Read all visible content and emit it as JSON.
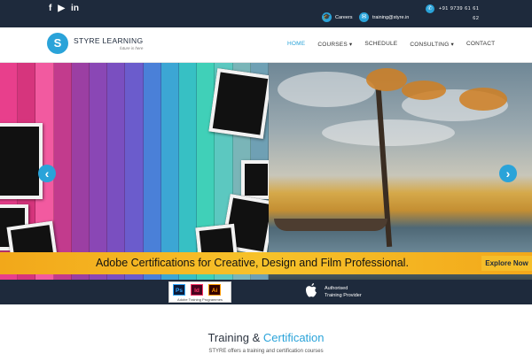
{
  "topbar": {
    "social": [
      {
        "icon": "facebook-icon",
        "glyph": "f"
      },
      {
        "icon": "youtube-icon",
        "glyph": "▶"
      },
      {
        "icon": "linkedin-icon",
        "glyph": "in"
      }
    ],
    "careers_label": "Careers",
    "email": "training@styre.in",
    "phone_line1": "+91 9739 61 61",
    "phone_line2": "62"
  },
  "logo": {
    "mark": "S",
    "name": "STYRE LEARNING",
    "tagline": "future is here"
  },
  "menu": [
    {
      "label": "HOME",
      "active": true
    },
    {
      "label": "COURSES ▾",
      "active": false
    },
    {
      "label": "SCHEDULE",
      "active": false
    },
    {
      "label": "CONSULTING ▾",
      "active": false
    },
    {
      "label": "CONTACT",
      "active": false
    }
  ],
  "slider": {
    "prev_glyph": "‹",
    "next_glyph": "›",
    "banner_text": "Adobe Certifications for Creative, Design and Film Professional.",
    "explore_label": "Explore Now"
  },
  "partners": {
    "adobe_icons": [
      {
        "text": "Ps",
        "bg": "#0c1b3a",
        "fg": "#31a8ff"
      },
      {
        "text": "Id",
        "bg": "#49021f",
        "fg": "#ff3366"
      },
      {
        "text": "Ai",
        "bg": "#330000",
        "fg": "#ff9a00"
      }
    ],
    "adobe_label": "Adobe Training Programmes",
    "apple_line1": "Authorised",
    "apple_line2": "Training Provider"
  },
  "section": {
    "heading_main": "Training &",
    "heading_accent": "Certification",
    "subtitle": "STYRE offers a training and certification courses"
  },
  "colors": {
    "navy": "#1e2a3c",
    "accent": "#2aa3d9",
    "banner": "#f2a81a"
  },
  "planks": [
    "#e83f8c",
    "#d6357d",
    "#f25aa0",
    "#c23b8d",
    "#9b3fa3",
    "#8a47b5",
    "#7a4fc0",
    "#6b5ccc",
    "#4a80d8",
    "#3ca6d4",
    "#37c0c4",
    "#40d0b8",
    "#5cc8c0",
    "#7ab5b8",
    "#6fa0b4"
  ]
}
